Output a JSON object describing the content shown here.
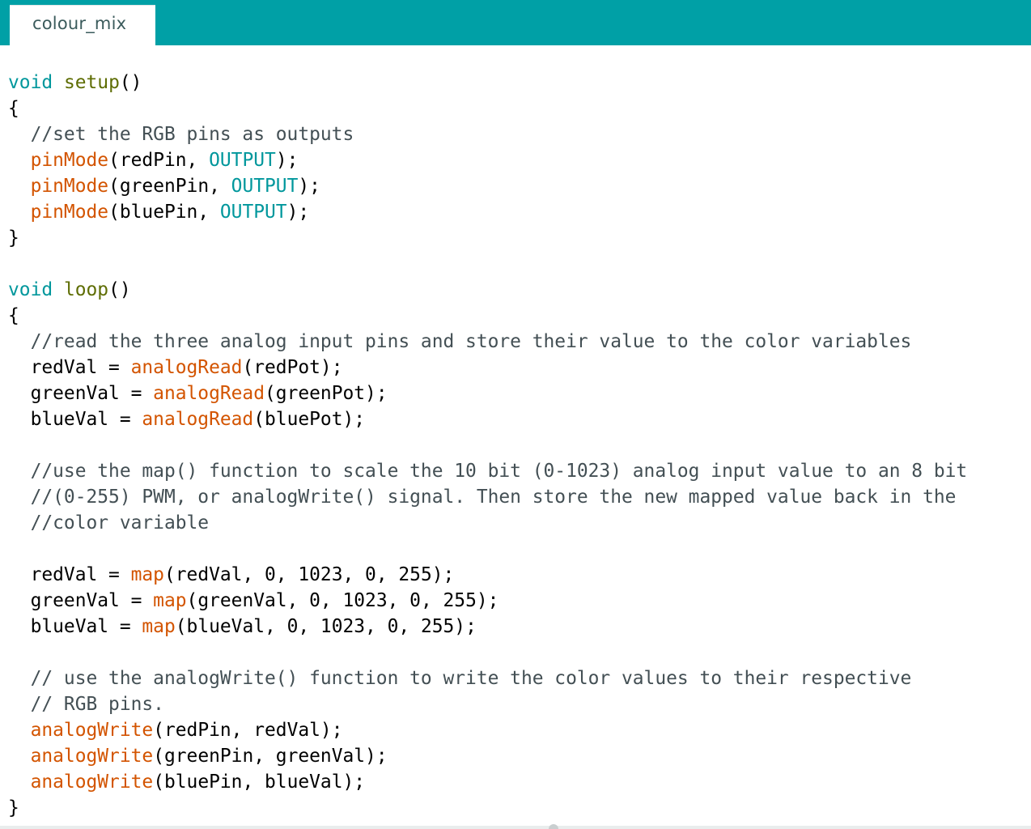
{
  "tab": {
    "label": "colour_mix"
  },
  "colors": {
    "tabbar": "#00A0A6",
    "keyword": "#00979C",
    "function_name": "#5E6D03",
    "api_call": "#D35400",
    "comment": "#434f54"
  },
  "code_lines": [
    [
      {
        "t": "kw",
        "s": "void"
      },
      {
        "t": "plain",
        "s": " "
      },
      {
        "t": "fn",
        "s": "setup"
      },
      {
        "t": "plain",
        "s": "()"
      }
    ],
    [
      {
        "t": "plain",
        "s": "{"
      }
    ],
    [
      {
        "t": "comment",
        "s": "  //set the RGB pins as outputs"
      }
    ],
    [
      {
        "t": "plain",
        "s": "  "
      },
      {
        "t": "api",
        "s": "pinMode"
      },
      {
        "t": "plain",
        "s": "(redPin, "
      },
      {
        "t": "const",
        "s": "OUTPUT"
      },
      {
        "t": "plain",
        "s": ");"
      }
    ],
    [
      {
        "t": "plain",
        "s": "  "
      },
      {
        "t": "api",
        "s": "pinMode"
      },
      {
        "t": "plain",
        "s": "(greenPin, "
      },
      {
        "t": "const",
        "s": "OUTPUT"
      },
      {
        "t": "plain",
        "s": ");"
      }
    ],
    [
      {
        "t": "plain",
        "s": "  "
      },
      {
        "t": "api",
        "s": "pinMode"
      },
      {
        "t": "plain",
        "s": "(bluePin, "
      },
      {
        "t": "const",
        "s": "OUTPUT"
      },
      {
        "t": "plain",
        "s": ");"
      }
    ],
    [
      {
        "t": "plain",
        "s": "}"
      }
    ],
    [
      {
        "t": "plain",
        "s": ""
      }
    ],
    [
      {
        "t": "kw",
        "s": "void"
      },
      {
        "t": "plain",
        "s": " "
      },
      {
        "t": "fn",
        "s": "loop"
      },
      {
        "t": "plain",
        "s": "()"
      }
    ],
    [
      {
        "t": "plain",
        "s": "{"
      }
    ],
    [
      {
        "t": "comment",
        "s": "  //read the three analog input pins and store their value to the color variables"
      }
    ],
    [
      {
        "t": "plain",
        "s": "  redVal = "
      },
      {
        "t": "api",
        "s": "analogRead"
      },
      {
        "t": "plain",
        "s": "(redPot);"
      }
    ],
    [
      {
        "t": "plain",
        "s": "  greenVal = "
      },
      {
        "t": "api",
        "s": "analogRead"
      },
      {
        "t": "plain",
        "s": "(greenPot);"
      }
    ],
    [
      {
        "t": "plain",
        "s": "  blueVal = "
      },
      {
        "t": "api",
        "s": "analogRead"
      },
      {
        "t": "plain",
        "s": "(bluePot);"
      }
    ],
    [
      {
        "t": "plain",
        "s": ""
      }
    ],
    [
      {
        "t": "comment",
        "s": "  //use the map() function to scale the 10 bit (0-1023) analog input value to an 8 bit"
      }
    ],
    [
      {
        "t": "comment",
        "s": "  //(0-255) PWM, or analogWrite() signal. Then store the new mapped value back in the"
      }
    ],
    [
      {
        "t": "comment",
        "s": "  //color variable"
      }
    ],
    [
      {
        "t": "plain",
        "s": ""
      }
    ],
    [
      {
        "t": "plain",
        "s": "  redVal = "
      },
      {
        "t": "api",
        "s": "map"
      },
      {
        "t": "plain",
        "s": "(redVal, 0, 1023, 0, 255);"
      }
    ],
    [
      {
        "t": "plain",
        "s": "  greenVal = "
      },
      {
        "t": "api",
        "s": "map"
      },
      {
        "t": "plain",
        "s": "(greenVal, 0, 1023, 0, 255);"
      }
    ],
    [
      {
        "t": "plain",
        "s": "  blueVal = "
      },
      {
        "t": "api",
        "s": "map"
      },
      {
        "t": "plain",
        "s": "(blueVal, 0, 1023, 0, 255);"
      }
    ],
    [
      {
        "t": "plain",
        "s": ""
      }
    ],
    [
      {
        "t": "comment",
        "s": "  // use the analogWrite() function to write the color values to their respective"
      }
    ],
    [
      {
        "t": "comment",
        "s": "  // RGB pins."
      }
    ],
    [
      {
        "t": "plain",
        "s": "  "
      },
      {
        "t": "api",
        "s": "analogWrite"
      },
      {
        "t": "plain",
        "s": "(redPin, redVal);"
      }
    ],
    [
      {
        "t": "plain",
        "s": "  "
      },
      {
        "t": "api",
        "s": "analogWrite"
      },
      {
        "t": "plain",
        "s": "(greenPin, greenVal);"
      }
    ],
    [
      {
        "t": "plain",
        "s": "  "
      },
      {
        "t": "api",
        "s": "analogWrite"
      },
      {
        "t": "plain",
        "s": "(bluePin, blueVal);"
      }
    ],
    [
      {
        "t": "plain",
        "s": "}"
      }
    ]
  ]
}
